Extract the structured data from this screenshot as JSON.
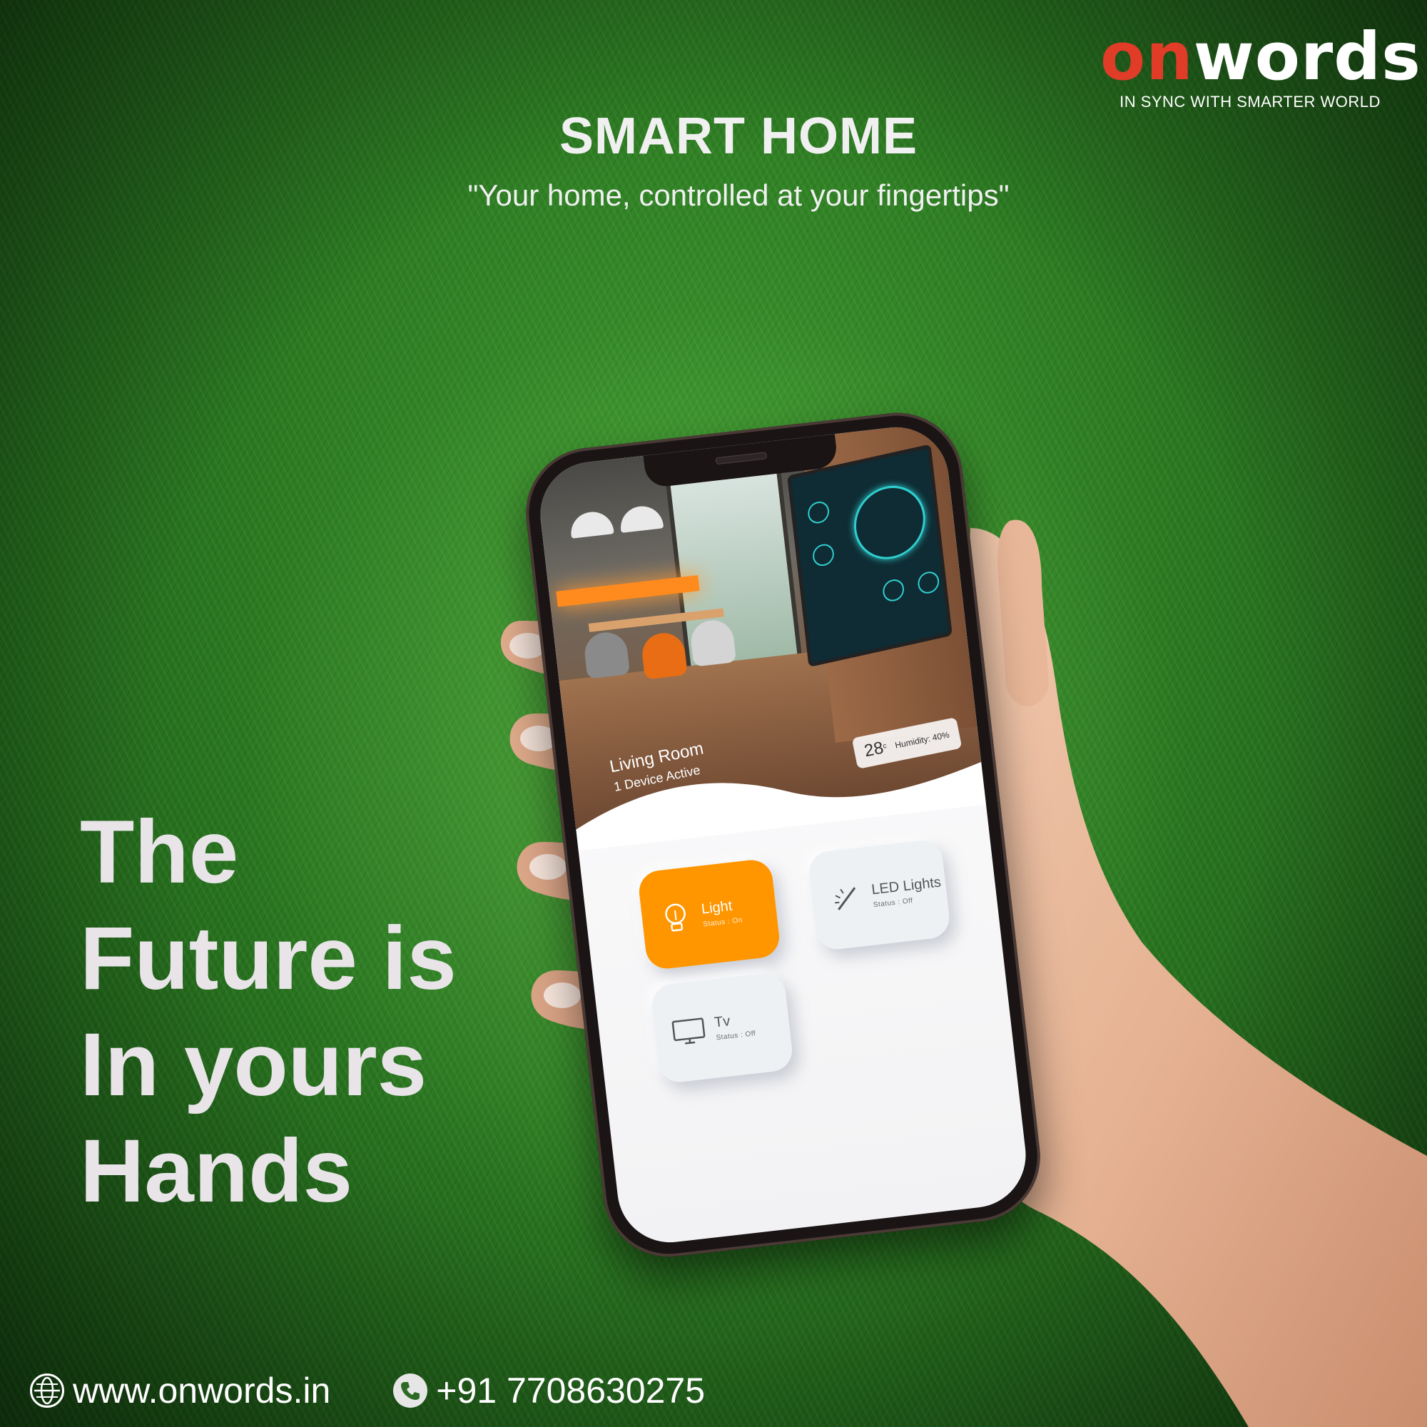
{
  "brand": {
    "logo_on": "on",
    "logo_rest": "words",
    "tagline": "IN SYNC WITH SMARTER WORLD",
    "colors": {
      "accent": "#e03c28",
      "orange": "#ff9600",
      "grass": "#2b7a21"
    }
  },
  "headline": {
    "title": "SMART HOME",
    "subtitle": "\"Your home, controlled at your fingertips\""
  },
  "slogan": {
    "lines": [
      "The",
      "Future is",
      "In yours",
      "Hands"
    ]
  },
  "phone_app": {
    "room_name": "Living Room",
    "active_devices": "1 Device Active",
    "temperature": "28",
    "temperature_unit": "c",
    "humidity": "Humidity: 40%",
    "devices": [
      {
        "name": "Light",
        "status": "Status : On",
        "icon": "bulb-icon"
      },
      {
        "name": "LED Lights",
        "status": "Status : Off",
        "icon": "led-strip-icon"
      },
      {
        "name": "Tv",
        "status": "Status : Off",
        "icon": "tv-icon"
      }
    ]
  },
  "footer": {
    "website": "www.onwords.in",
    "phone": "+91 7708630275",
    "website_icon": "globe-icon",
    "phone_icon": "phone-icon"
  }
}
